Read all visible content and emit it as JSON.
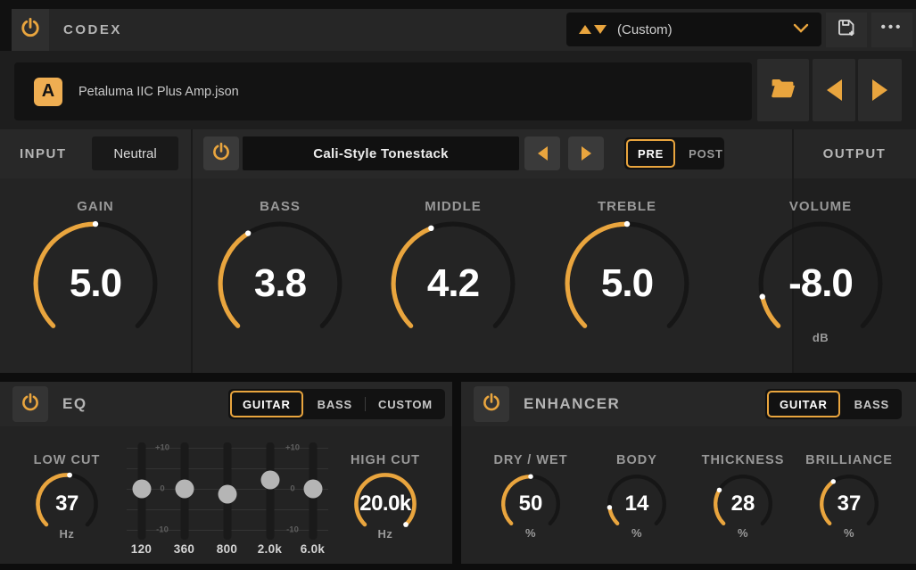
{
  "colors": {
    "accent": "#e9a53e",
    "knob_track": "#161616",
    "slider_handle": "#b5b5b5",
    "badge": "#efae52"
  },
  "topbar": {
    "title": "CODEX",
    "preset_value": "(Custom)",
    "menu_dots": "•••"
  },
  "file_row": {
    "badge": "A",
    "filename": "Petaluma IIC Plus Amp.json"
  },
  "io": {
    "input_label": "INPUT",
    "input_value": "Neutral",
    "tonestack_name": "Cali-Style Tonestack",
    "pre": "PRE",
    "post": "POST",
    "routing_selected": "PRE",
    "output_label": "OUTPUT"
  },
  "amp_knobs": [
    {
      "label": "GAIN",
      "value": "5.0",
      "unit": "",
      "fraction": 0.5
    },
    {
      "label": "BASS",
      "value": "3.8",
      "unit": "",
      "fraction": 0.38
    },
    {
      "label": "MIDDLE",
      "value": "4.2",
      "unit": "",
      "fraction": 0.42
    },
    {
      "label": "TREBLE",
      "value": "5.0",
      "unit": "",
      "fraction": 0.5
    },
    {
      "label": "VOLUME",
      "value": "-8.0",
      "unit": "dB",
      "fraction": 0.12
    }
  ],
  "eq": {
    "title": "EQ",
    "tabs": [
      "GUITAR",
      "BASS",
      "CUSTOM"
    ],
    "selected_tab": "GUITAR",
    "low_cut": {
      "label": "LOW CUT",
      "value": "37",
      "unit": "Hz",
      "fraction": 0.52
    },
    "high_cut": {
      "label": "HIGH CUT",
      "value": "20.0k",
      "unit": "Hz",
      "fraction": 1.0
    },
    "scale": {
      "top": "+10",
      "mid": "0",
      "bottom": "-10"
    },
    "bands": [
      {
        "freq": "120",
        "db": 0
      },
      {
        "freq": "360",
        "db": 0
      },
      {
        "freq": "800",
        "db": -1.5
      },
      {
        "freq": "2.0k",
        "db": 2
      },
      {
        "freq": "6.0k",
        "db": 0
      }
    ]
  },
  "enhancer": {
    "title": "ENHANCER",
    "tabs": [
      "GUITAR",
      "BASS"
    ],
    "selected_tab": "GUITAR",
    "knobs": [
      {
        "label": "DRY / WET",
        "value": "50",
        "unit": "%",
        "fraction": 0.5
      },
      {
        "label": "BODY",
        "value": "14",
        "unit": "%",
        "fraction": 0.14
      },
      {
        "label": "THICKNESS",
        "value": "28",
        "unit": "%",
        "fraction": 0.28
      },
      {
        "label": "BRILLIANCE",
        "value": "37",
        "unit": "%",
        "fraction": 0.37
      }
    ]
  }
}
